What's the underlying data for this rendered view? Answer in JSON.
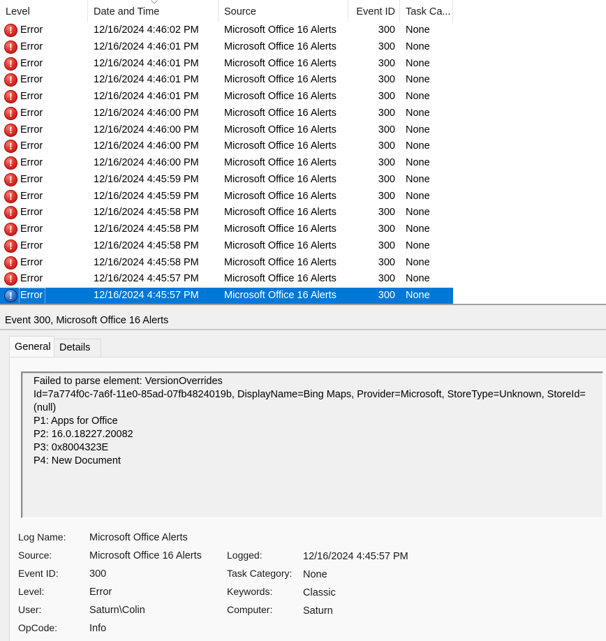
{
  "columns": {
    "level": "Level",
    "date_time": "Date and Time",
    "source": "Source",
    "event_id": "Event ID",
    "task_category": "Task Ca..."
  },
  "events": [
    {
      "level": "Error",
      "date_time": "12/16/2024 4:46:02 PM",
      "source": "Microsoft Office 16 Alerts",
      "event_id": "300",
      "task": "None"
    },
    {
      "level": "Error",
      "date_time": "12/16/2024 4:46:01 PM",
      "source": "Microsoft Office 16 Alerts",
      "event_id": "300",
      "task": "None"
    },
    {
      "level": "Error",
      "date_time": "12/16/2024 4:46:01 PM",
      "source": "Microsoft Office 16 Alerts",
      "event_id": "300",
      "task": "None"
    },
    {
      "level": "Error",
      "date_time": "12/16/2024 4:46:01 PM",
      "source": "Microsoft Office 16 Alerts",
      "event_id": "300",
      "task": "None"
    },
    {
      "level": "Error",
      "date_time": "12/16/2024 4:46:01 PM",
      "source": "Microsoft Office 16 Alerts",
      "event_id": "300",
      "task": "None"
    },
    {
      "level": "Error",
      "date_time": "12/16/2024 4:46:00 PM",
      "source": "Microsoft Office 16 Alerts",
      "event_id": "300",
      "task": "None"
    },
    {
      "level": "Error",
      "date_time": "12/16/2024 4:46:00 PM",
      "source": "Microsoft Office 16 Alerts",
      "event_id": "300",
      "task": "None"
    },
    {
      "level": "Error",
      "date_time": "12/16/2024 4:46:00 PM",
      "source": "Microsoft Office 16 Alerts",
      "event_id": "300",
      "task": "None"
    },
    {
      "level": "Error",
      "date_time": "12/16/2024 4:46:00 PM",
      "source": "Microsoft Office 16 Alerts",
      "event_id": "300",
      "task": "None"
    },
    {
      "level": "Error",
      "date_time": "12/16/2024 4:45:59 PM",
      "source": "Microsoft Office 16 Alerts",
      "event_id": "300",
      "task": "None"
    },
    {
      "level": "Error",
      "date_time": "12/16/2024 4:45:59 PM",
      "source": "Microsoft Office 16 Alerts",
      "event_id": "300",
      "task": "None"
    },
    {
      "level": "Error",
      "date_time": "12/16/2024 4:45:58 PM",
      "source": "Microsoft Office 16 Alerts",
      "event_id": "300",
      "task": "None"
    },
    {
      "level": "Error",
      "date_time": "12/16/2024 4:45:58 PM",
      "source": "Microsoft Office 16 Alerts",
      "event_id": "300",
      "task": "None"
    },
    {
      "level": "Error",
      "date_time": "12/16/2024 4:45:58 PM",
      "source": "Microsoft Office 16 Alerts",
      "event_id": "300",
      "task": "None"
    },
    {
      "level": "Error",
      "date_time": "12/16/2024 4:45:58 PM",
      "source": "Microsoft Office 16 Alerts",
      "event_id": "300",
      "task": "None"
    },
    {
      "level": "Error",
      "date_time": "12/16/2024 4:45:57 PM",
      "source": "Microsoft Office 16 Alerts",
      "event_id": "300",
      "task": "None"
    },
    {
      "level": "Error",
      "date_time": "12/16/2024 4:45:57 PM",
      "source": "Microsoft Office 16 Alerts",
      "event_id": "300",
      "task": "None",
      "selected": true
    }
  ],
  "details": {
    "title": "Event 300, Microsoft Office 16 Alerts",
    "tabs": {
      "general": "General",
      "details": "Details"
    },
    "message_lines": [
      "Failed to parse element: VersionOverrides",
      "Id=7a774f0c-7a6f-11e0-85ad-07fb4824019b, DisplayName=Bing Maps, Provider=Microsoft, StoreType=Unknown, StoreId=",
      "(null)",
      "P1: Apps for Office",
      "P2: 16.0.18227.20082",
      "P3: 0x8004323E",
      "P4: New Document"
    ],
    "properties": {
      "log_name_label": "Log Name:",
      "log_name": "Microsoft Office Alerts",
      "source_label": "Source:",
      "source": "Microsoft Office 16 Alerts",
      "event_id_label": "Event ID:",
      "event_id": "300",
      "level_label": "Level:",
      "level": "Error",
      "user_label": "User:",
      "user": "Saturn\\Colin",
      "opcode_label": "OpCode:",
      "opcode": "Info",
      "logged_label": "Logged:",
      "logged": "12/16/2024 4:45:57 PM",
      "task_category_label": "Task Category:",
      "task_category": "None",
      "keywords_label": "Keywords:",
      "keywords": "Classic",
      "computer_label": "Computer:",
      "computer": "Saturn"
    }
  },
  "colors": {
    "selection": "#0078d7",
    "error_icon": "#d9302a",
    "pane_bg": "#f0f0f0"
  },
  "icons": {
    "error": "error-icon",
    "sort": "sort-caret-icon"
  }
}
